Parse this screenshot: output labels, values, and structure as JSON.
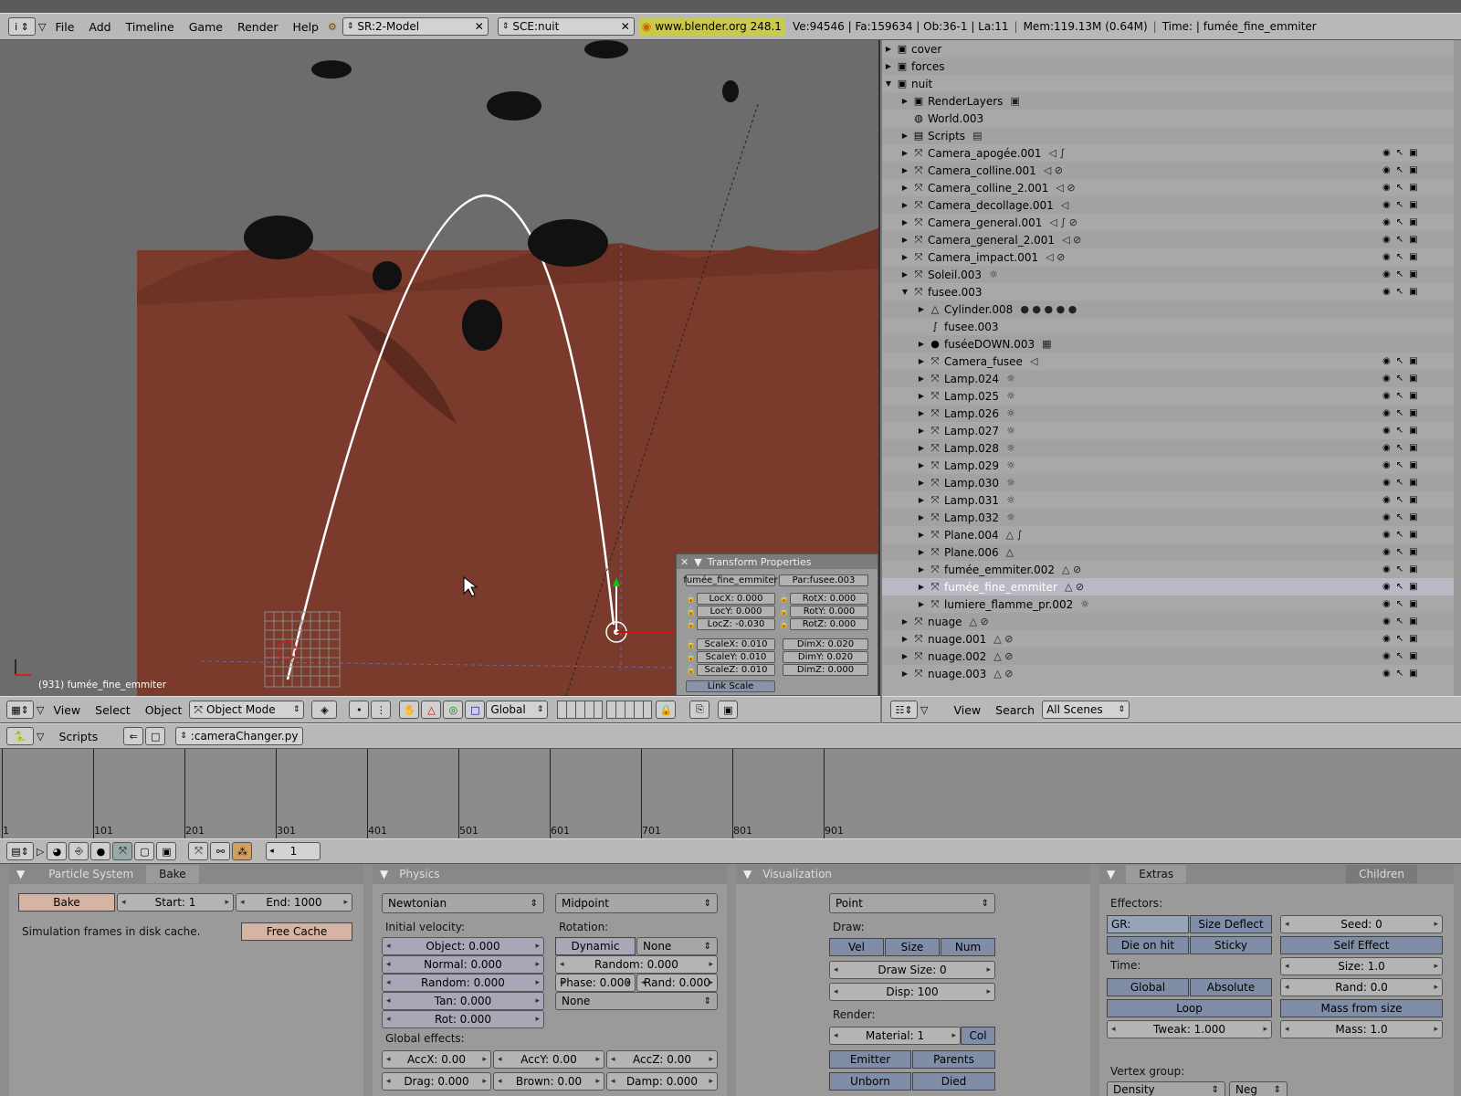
{
  "top_menu": {
    "items": [
      "File",
      "Add",
      "Timeline",
      "Game",
      "Render",
      "Help"
    ],
    "screen": "SR:2-Model",
    "scene": "SCE:nuit",
    "version": "www.blender.org 248.1",
    "stats": "Ve:94546 | Fa:159634 | Ob:36-1 | La:11",
    "mem": "Mem:119.13M (0.64M)",
    "time": "Time: | fumée_fine_emmiter"
  },
  "viewport": {
    "status": "(931) fumée_fine_emmiter",
    "menus": [
      "View",
      "Select",
      "Object"
    ],
    "mode": "Object Mode",
    "orientation": "Global"
  },
  "transform": {
    "title": "Transform Properties",
    "object": "fumée_fine_emmiter",
    "parent": "Par:fusee.003",
    "loc": [
      "LocX: 0.000",
      "LocY: 0.000",
      "LocZ: -0.030"
    ],
    "rot": [
      "RotX: 0.000",
      "RotY: 0.000",
      "RotZ: 0.000"
    ],
    "scale": [
      "ScaleX: 0.010",
      "ScaleY: 0.010",
      "ScaleZ: 0.010"
    ],
    "dim": [
      "DimX: 0.020",
      "DimY: 0.020",
      "DimZ: 0.000"
    ],
    "link": "Link Scale"
  },
  "outliner": {
    "rows": [
      {
        "d": 0,
        "open": false,
        "icon": "scene-icon",
        "name": "cover",
        "extra": ""
      },
      {
        "d": 0,
        "open": false,
        "icon": "scene-icon",
        "name": "forces",
        "extra": ""
      },
      {
        "d": 0,
        "open": true,
        "icon": "scene-icon",
        "name": "nuit",
        "extra": ""
      },
      {
        "d": 1,
        "open": false,
        "icon": "renderlayer-icon",
        "name": "RenderLayers",
        "extra": "▣"
      },
      {
        "d": 1,
        "open": null,
        "icon": "world-icon",
        "name": "World.003",
        "extra": ""
      },
      {
        "d": 1,
        "open": false,
        "icon": "script-icon",
        "name": "Scripts",
        "extra": "▤"
      },
      {
        "d": 1,
        "open": false,
        "icon": "object-icon",
        "name": "Camera_apogée.001",
        "extra": "◁ ∫",
        "vis": true
      },
      {
        "d": 1,
        "open": false,
        "icon": "object-icon",
        "name": "Camera_colline.001",
        "extra": "◁ ⊘",
        "vis": true
      },
      {
        "d": 1,
        "open": false,
        "icon": "object-icon",
        "name": "Camera_colline_2.001",
        "extra": "◁ ⊘",
        "vis": true
      },
      {
        "d": 1,
        "open": false,
        "icon": "object-icon",
        "name": "Camera_decollage.001",
        "extra": "◁",
        "vis": true
      },
      {
        "d": 1,
        "open": false,
        "icon": "object-icon",
        "name": "Camera_general.001",
        "extra": "◁ ∫ ⊘",
        "vis": true
      },
      {
        "d": 1,
        "open": false,
        "icon": "object-icon",
        "name": "Camera_general_2.001",
        "extra": "◁ ⊘",
        "vis": true
      },
      {
        "d": 1,
        "open": false,
        "icon": "object-icon",
        "name": "Camera_impact.001",
        "extra": "◁ ⊘",
        "vis": true
      },
      {
        "d": 1,
        "open": false,
        "icon": "object-icon",
        "name": "Soleil.003",
        "extra": "☼",
        "vis": true
      },
      {
        "d": 1,
        "open": true,
        "icon": "object-icon",
        "name": "fusee.003",
        "extra": "",
        "vis": true
      },
      {
        "d": 2,
        "open": false,
        "icon": "mesh-icon",
        "name": "Cylinder.008",
        "extra": "● ● ● ● ●"
      },
      {
        "d": 2,
        "open": null,
        "icon": "curve-icon",
        "name": "fusee.003",
        "extra": ""
      },
      {
        "d": 2,
        "open": false,
        "icon": "material-icon",
        "name": "fuséeDOWN.003",
        "extra": "▦"
      },
      {
        "d": 2,
        "open": false,
        "icon": "object-icon",
        "name": "Camera_fusee",
        "extra": "◁",
        "vis": true
      },
      {
        "d": 2,
        "open": false,
        "icon": "object-icon",
        "name": "Lamp.024",
        "extra": "☼",
        "vis": true
      },
      {
        "d": 2,
        "open": false,
        "icon": "object-icon",
        "name": "Lamp.025",
        "extra": "☼",
        "vis": true
      },
      {
        "d": 2,
        "open": false,
        "icon": "object-icon",
        "name": "Lamp.026",
        "extra": "☼",
        "vis": true
      },
      {
        "d": 2,
        "open": false,
        "icon": "object-icon",
        "name": "Lamp.027",
        "extra": "☼",
        "vis": true
      },
      {
        "d": 2,
        "open": false,
        "icon": "object-icon",
        "name": "Lamp.028",
        "extra": "☼",
        "vis": true
      },
      {
        "d": 2,
        "open": false,
        "icon": "object-icon",
        "name": "Lamp.029",
        "extra": "☼",
        "vis": true
      },
      {
        "d": 2,
        "open": false,
        "icon": "object-icon",
        "name": "Lamp.030",
        "extra": "☼",
        "vis": true
      },
      {
        "d": 2,
        "open": false,
        "icon": "object-icon",
        "name": "Lamp.031",
        "extra": "☼",
        "vis": true
      },
      {
        "d": 2,
        "open": false,
        "icon": "object-icon",
        "name": "Lamp.032",
        "extra": "☼",
        "vis": true
      },
      {
        "d": 2,
        "open": false,
        "icon": "object-icon",
        "name": "Plane.004",
        "extra": "△ ∫",
        "vis": true
      },
      {
        "d": 2,
        "open": false,
        "icon": "object-icon",
        "name": "Plane.006",
        "extra": "△",
        "vis": true
      },
      {
        "d": 2,
        "open": false,
        "icon": "object-icon",
        "name": "fumée_emmiter.002",
        "extra": "△ ⊘",
        "vis": true
      },
      {
        "d": 2,
        "open": false,
        "icon": "object-icon",
        "name": "fumée_fine_emmiter",
        "extra": "△ ⊘",
        "vis": true,
        "sel": true
      },
      {
        "d": 2,
        "open": false,
        "icon": "object-icon",
        "name": "lumiere_flamme_pr.002",
        "extra": "☼",
        "vis": true
      },
      {
        "d": 1,
        "open": false,
        "icon": "object-icon",
        "name": "nuage",
        "extra": "△ ⊘",
        "vis": true
      },
      {
        "d": 1,
        "open": false,
        "icon": "object-icon",
        "name": "nuage.001",
        "extra": "△ ⊘",
        "vis": true
      },
      {
        "d": 1,
        "open": false,
        "icon": "object-icon",
        "name": "nuage.002",
        "extra": "△ ⊘",
        "vis": true
      },
      {
        "d": 1,
        "open": false,
        "icon": "object-icon",
        "name": "nuage.003",
        "extra": "△ ⊘",
        "vis": true
      }
    ],
    "menus": [
      "View",
      "Search"
    ],
    "filter": "All Scenes"
  },
  "scripts": {
    "label": "Scripts",
    "file": ":cameraChanger.py"
  },
  "timeline": {
    "ticks": [
      "1",
      "101",
      "201",
      "301",
      "401",
      "501",
      "601",
      "701",
      "801",
      "901"
    ]
  },
  "buttons": {
    "frame": "1",
    "particle": {
      "tab1": "Particle System",
      "tab2": "Bake",
      "bake": "Bake",
      "start": "Start: 1",
      "end": "End: 1000",
      "cache_text": "Simulation frames in disk cache.",
      "free": "Free Cache"
    },
    "physics": {
      "title": "Physics",
      "type": "Newtonian",
      "integrator": "Midpoint",
      "init_vel": "Initial velocity:",
      "object": "Object: 0.000",
      "normal": "Normal: 0.000",
      "random": "Random: 0.000",
      "tan": "Tan: 0.000",
      "rot": "Rot: 0.000",
      "rotation": "Rotation:",
      "dynamic": "Dynamic",
      "none1": "None",
      "rrandom": "Random: 0.000",
      "phase": "Phase: 0.000",
      "rand": "Rand: 0.000",
      "none2": "None",
      "global": "Global effects:",
      "accx": "AccX: 0.00",
      "accy": "AccY: 0.00",
      "accz": "AccZ: 0.00",
      "drag": "Drag: 0.000",
      "brown": "Brown: 0.00",
      "damp": "Damp: 0.000"
    },
    "visual": {
      "title": "Visualization",
      "type": "Point",
      "draw": "Draw:",
      "vel": "Vel",
      "size": "Size",
      "num": "Num",
      "drawsize": "Draw Size: 0",
      "disp": "Disp: 100",
      "render": "Render:",
      "material": "Material: 1",
      "col": "Col",
      "emitter": "Emitter",
      "parents": "Parents",
      "unborn": "Unborn",
      "died": "Died"
    },
    "extras": {
      "tab1": "Extras",
      "tab2": "Children",
      "effectors": "Effectors:",
      "gr": "GR:",
      "sizedef": "Size Deflect",
      "seed": "Seed: 0",
      "dieonhit": "Die on hit",
      "sticky": "Sticky",
      "selfeffect": "Self Effect",
      "time": "Time:",
      "size": "Size: 1.0",
      "global": "Global",
      "absolute": "Absolute",
      "rand": "Rand: 0.0",
      "loop": "Loop",
      "mass_from_size": "Mass from size",
      "tweak": "Tweak: 1.000",
      "mass": "Mass: 1.0",
      "vgroup": "Vertex group:",
      "density": "Density",
      "neg": "Neg"
    }
  }
}
